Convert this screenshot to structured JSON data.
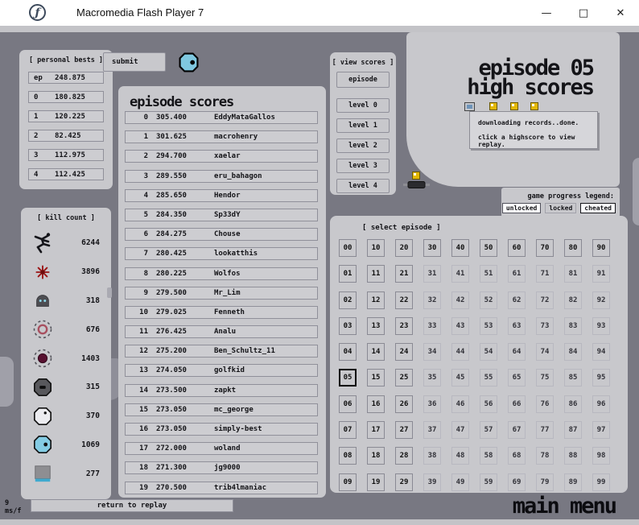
{
  "window": {
    "title": "Macromedia Flash Player 7"
  },
  "personal_bests": {
    "header": "[ personal bests ]",
    "rows": [
      {
        "label": "ep",
        "value": "248.875"
      },
      {
        "label": "0",
        "value": "180.825"
      },
      {
        "label": "1",
        "value": "120.225"
      },
      {
        "label": "2",
        "value": "82.425"
      },
      {
        "label": "3",
        "value": "112.975"
      },
      {
        "label": "4",
        "value": "112.425"
      }
    ]
  },
  "submit_label": "submit",
  "kill_count": {
    "header": "[ kill count ]",
    "rows": [
      {
        "icon": "ninja",
        "count": "6244"
      },
      {
        "icon": "mine",
        "count": "3896"
      },
      {
        "icon": "guard-robot",
        "count": "318"
      },
      {
        "icon": "seeker-ring",
        "count": "676"
      },
      {
        "icon": "seeker-filled",
        "count": "1403"
      },
      {
        "icon": "octagon-dark",
        "count": "315"
      },
      {
        "icon": "octagon-white",
        "count": "370"
      },
      {
        "icon": "octagon-blue",
        "count": "1069"
      },
      {
        "icon": "thwump",
        "count": "277"
      }
    ]
  },
  "episode_scores": {
    "title": "episode scores",
    "rows": [
      {
        "rank": "0",
        "score": "305.400",
        "name": "EddyMataGallos"
      },
      {
        "rank": "1",
        "score": "301.625",
        "name": "macrohenry"
      },
      {
        "rank": "2",
        "score": "294.700",
        "name": "xaelar"
      },
      {
        "rank": "3",
        "score": "289.550",
        "name": "eru_bahagon"
      },
      {
        "rank": "4",
        "score": "285.650",
        "name": "Hendor"
      },
      {
        "rank": "5",
        "score": "284.350",
        "name": "Sp33dY"
      },
      {
        "rank": "6",
        "score": "284.275",
        "name": "Chouse"
      },
      {
        "rank": "7",
        "score": "280.425",
        "name": "lookatthis"
      },
      {
        "rank": "8",
        "score": "280.225",
        "name": "Wolfos"
      },
      {
        "rank": "9",
        "score": "279.500",
        "name": "Mr_Lim"
      },
      {
        "rank": "10",
        "score": "279.025",
        "name": "Fenneth"
      },
      {
        "rank": "11",
        "score": "276.425",
        "name": "Analu"
      },
      {
        "rank": "12",
        "score": "275.200",
        "name": "Ben_Schultz_11"
      },
      {
        "rank": "13",
        "score": "274.050",
        "name": "golfkid"
      },
      {
        "rank": "14",
        "score": "273.500",
        "name": "zapkt"
      },
      {
        "rank": "15",
        "score": "273.050",
        "name": "mc_george"
      },
      {
        "rank": "16",
        "score": "273.050",
        "name": "simply-best"
      },
      {
        "rank": "17",
        "score": "272.000",
        "name": "woland"
      },
      {
        "rank": "18",
        "score": "271.300",
        "name": "jg9000"
      },
      {
        "rank": "19",
        "score": "270.500",
        "name": "trib4lmaniac"
      }
    ]
  },
  "view_scores": {
    "header": "[ view scores ]",
    "buttons": [
      "episode",
      "level 0",
      "level 1",
      "level 2",
      "level 3",
      "level 4"
    ]
  },
  "highscores_title": {
    "line1": "episode 05",
    "line2": "high scores"
  },
  "status_box": {
    "line1": "downloading records..done.",
    "line2": "click a highscore to view replay."
  },
  "legend": {
    "label": "game progress legend:",
    "buttons": [
      "unlocked",
      "locked",
      "cheated"
    ]
  },
  "episode_grid": {
    "header": "[ select episode ]",
    "selected": "05",
    "unlocked": [
      "00",
      "01",
      "02",
      "03",
      "04",
      "05",
      "06",
      "07",
      "08",
      "09",
      "10",
      "11",
      "12",
      "13",
      "14",
      "15",
      "16",
      "17",
      "18",
      "19",
      "20",
      "21",
      "22",
      "23",
      "24",
      "25",
      "26",
      "27",
      "28",
      "29",
      "30",
      "40",
      "50",
      "60",
      "70",
      "80",
      "90"
    ],
    "rows": [
      [
        "00",
        "10",
        "20",
        "30",
        "40",
        "50",
        "60",
        "70",
        "80",
        "90"
      ],
      [
        "01",
        "11",
        "21",
        "31",
        "41",
        "51",
        "61",
        "71",
        "81",
        "91"
      ],
      [
        "02",
        "12",
        "22",
        "32",
        "42",
        "52",
        "62",
        "72",
        "82",
        "92"
      ],
      [
        "03",
        "13",
        "23",
        "33",
        "43",
        "53",
        "63",
        "73",
        "83",
        "93"
      ],
      [
        "04",
        "14",
        "24",
        "34",
        "44",
        "54",
        "64",
        "74",
        "84",
        "94"
      ],
      [
        "05",
        "15",
        "25",
        "35",
        "45",
        "55",
        "65",
        "75",
        "85",
        "95"
      ],
      [
        "06",
        "16",
        "26",
        "36",
        "46",
        "56",
        "66",
        "76",
        "86",
        "96"
      ],
      [
        "07",
        "17",
        "27",
        "37",
        "47",
        "57",
        "67",
        "77",
        "87",
        "97"
      ],
      [
        "08",
        "18",
        "28",
        "38",
        "48",
        "58",
        "68",
        "78",
        "88",
        "98"
      ],
      [
        "09",
        "19",
        "29",
        "39",
        "49",
        "59",
        "69",
        "79",
        "89",
        "99"
      ]
    ]
  },
  "footer": {
    "frame_ms": "9",
    "frame_unit": "ms/f",
    "return_label": "return to replay",
    "main_menu": "main menu"
  },
  "colors": {
    "background": "#787882",
    "panel": "#c8c8cc",
    "accent_blue": "#7fc8e0",
    "gold": "#e2b703"
  }
}
